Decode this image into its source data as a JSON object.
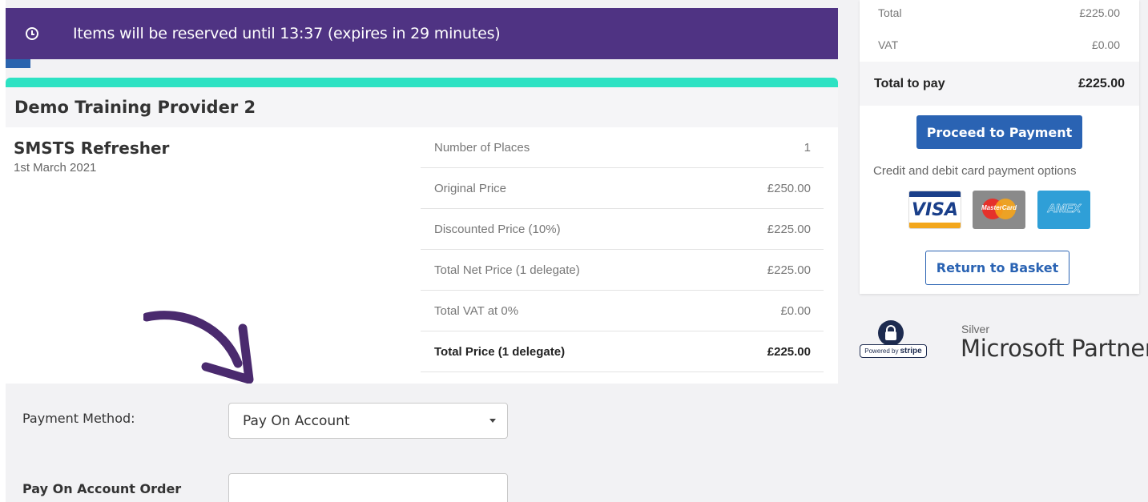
{
  "banner": {
    "icon": "clock-icon",
    "text": "Items will be reserved until 13:37 (expires in 29 minutes)",
    "color": "#4f3383"
  },
  "provider": {
    "title": "Demo Training Provider 2"
  },
  "course": {
    "name": "SMSTS Refresher",
    "date": "1st March 2021"
  },
  "price_table": [
    {
      "label": "Number of Places",
      "value": "1"
    },
    {
      "label": "Original Price",
      "value": "£250.00"
    },
    {
      "label": "Discounted Price (10%)",
      "value": "£225.00"
    },
    {
      "label": "Total Net Price (1 delegate)",
      "value": "£225.00"
    },
    {
      "label": "Total VAT at 0%",
      "value": "£0.00"
    },
    {
      "label": "Total Price (1 delegate)",
      "value": "£225.00"
    }
  ],
  "payment": {
    "method_label": "Payment Method:",
    "method_value": "Pay On Account",
    "order_label": "Pay On Account Order",
    "order_value": ""
  },
  "summary": {
    "total_label": "Total",
    "total_value": "£225.00",
    "vat_label": "VAT",
    "vat_value": "£0.00",
    "total_pay_label": "Total to pay",
    "total_pay_value": "£225.00",
    "proceed_label": "Proceed to Payment",
    "card_options": "Credit and debit card payment options",
    "return_label": "Return to Basket",
    "cards": {
      "visa": "VISA",
      "mastercard": "MasterCard",
      "amex": "AMEX"
    }
  },
  "badges": {
    "stripe_prefix": "Powered by",
    "stripe_name": "stripe",
    "ms_level": "Silver",
    "ms_name": "Microsoft Partner"
  },
  "colors": {
    "accent_teal": "#2de2c3",
    "button_blue": "#2a63b3",
    "banner_purple": "#4f3383"
  }
}
